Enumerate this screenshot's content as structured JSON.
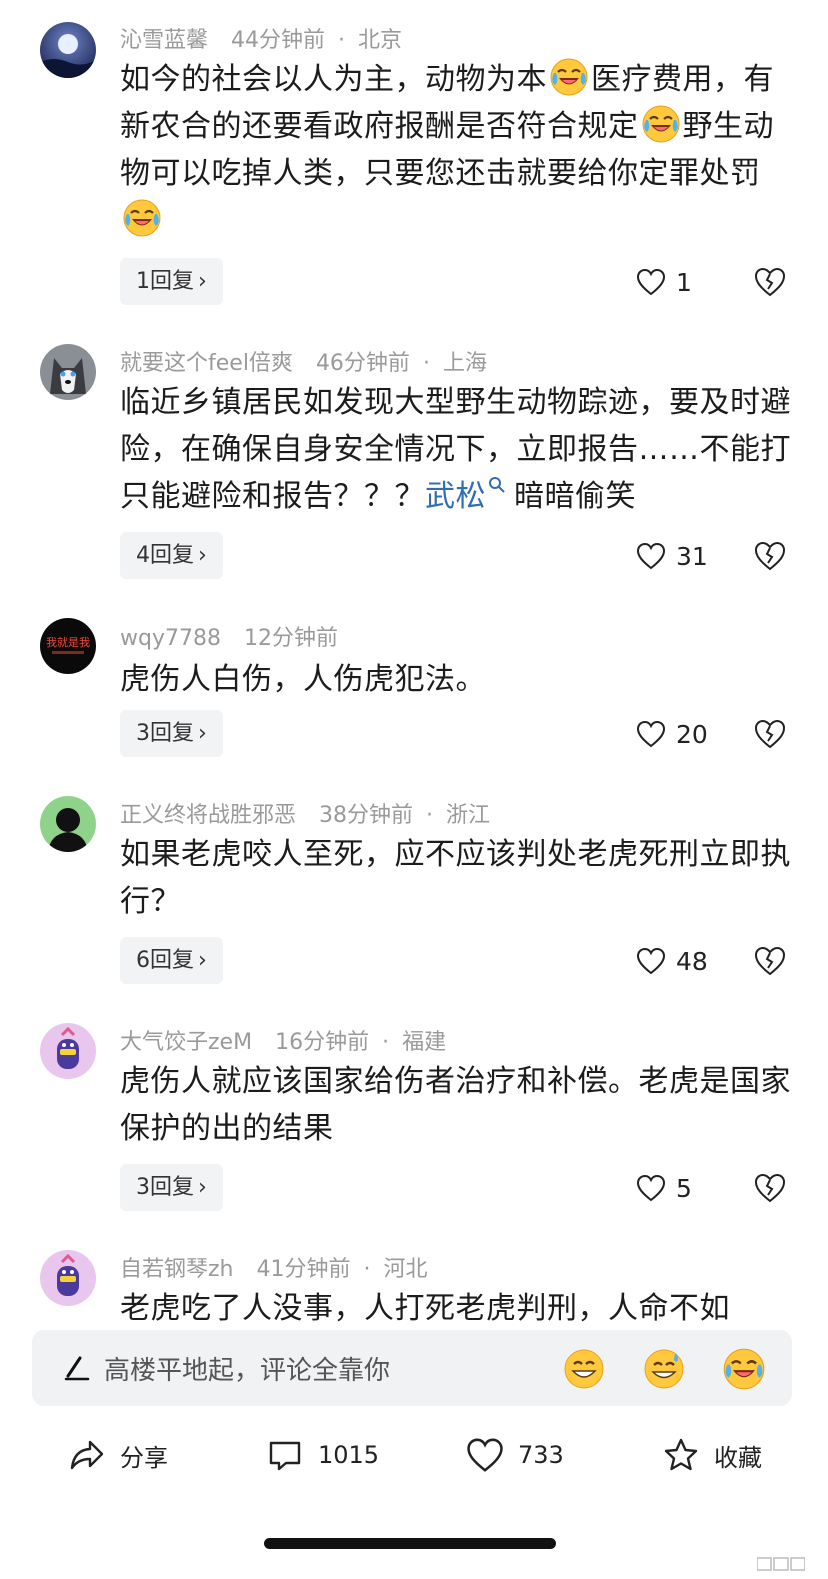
{
  "comments": [
    {
      "author": "沁雪蓝馨",
      "time": "44分钟前",
      "location": "北京",
      "avatar_icon": "moon-night-avatar",
      "text_parts": [
        "如今的社会以人为主，动物为本",
        "医疗费用，有新农合的还要看政府报酬是否符合规定",
        "野生动物可以吃掉人类，只要您还击就要给你定罪处罚"
      ],
      "replies": "1回复",
      "likes": "1"
    },
    {
      "author": "就要这个feel倍爽",
      "time": "46分钟前",
      "location": "上海",
      "avatar_icon": "husky-dog-avatar",
      "text_before": "临近乡镇居民如发现大型野生动物踪迹，要及时避险，在确保自身安全情况下，立即报告……不能打只能避险和报告？？？",
      "link": "武松",
      "text_after": "暗暗偷笑",
      "replies": "4回复",
      "likes": "31"
    },
    {
      "author": "wqy7788",
      "time": "12分钟前",
      "location": "",
      "avatar_icon": "text-logo-avatar",
      "avatar_text": "我就是我",
      "text": "虎伤人白伤，人伤虎犯法。",
      "replies": "3回复",
      "likes": "20"
    },
    {
      "author": "正义终将战胜邪恶",
      "time": "38分钟前",
      "location": "浙江",
      "avatar_icon": "silhouette-avatar",
      "text": "如果老虎咬人至死，应不应该判处老虎死刑立即执行？",
      "replies": "6回复",
      "likes": "48"
    },
    {
      "author": "大气饺子zeM",
      "time": "16分钟前",
      "location": "福建",
      "avatar_icon": "cartoon-character-avatar",
      "text": "虎伤人就应该国家给伤者治疗和补偿。老虎是国家保护的出的结果",
      "replies": "3回复",
      "likes": "5"
    },
    {
      "author": "自若钢琴zh",
      "time": "41分钟前",
      "location": "河北",
      "avatar_icon": "cartoon-character-avatar",
      "text": "老虎吃了人没事，人打死老虎判刑，人命不如"
    }
  ],
  "input": {
    "placeholder": "高楼平地起，评论全靠你",
    "emoji_buttons": [
      "grin-emoji",
      "sweat-smile-emoji",
      "laugh-cry-emoji"
    ]
  },
  "bottom_bar": {
    "share_label": "分享",
    "comment_count": "1015",
    "like_count": "733",
    "favorite_label": "收藏"
  },
  "colors": {
    "link": "#2f6db5",
    "meta": "#9a9a9a",
    "reply_bg": "#f2f3f5",
    "input_bg": "#f1f2f4"
  }
}
